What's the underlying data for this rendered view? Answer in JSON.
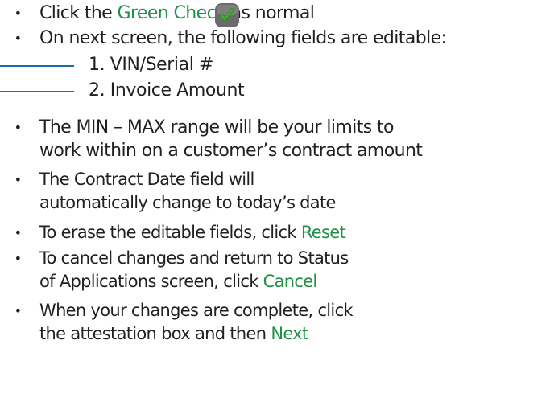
{
  "bullets": [
    {
      "lines": [
        {
          "pre": "Click the ",
          "accent": "Green Check",
          "post": " as normal"
        }
      ]
    },
    {
      "lines": [
        {
          "pre": "On next screen, the following fields are editable:",
          "accent": "",
          "post": ""
        }
      ]
    },
    {
      "lines": [
        {
          "pre": "The MIN – MAX range will be your limits to",
          "accent": "",
          "post": ""
        },
        {
          "pre": "work  within on a customer’s contract amount",
          "accent": "",
          "post": ""
        }
      ]
    },
    {
      "lines": [
        {
          "pre": "The Contract Date field will",
          "accent": "",
          "post": ""
        },
        {
          "pre": "automatically  change to today’s date",
          "accent": "",
          "post": ""
        }
      ]
    },
    {
      "lines": [
        {
          "pre": "To erase the editable fields, click ",
          "accent": "Reset",
          "post": ""
        }
      ]
    },
    {
      "lines": [
        {
          "pre": "To cancel changes and return to Status",
          "accent": "",
          "post": ""
        },
        {
          "pre": "of  Applications screen, click ",
          "accent": "Cancel",
          "post": ""
        }
      ]
    },
    {
      "lines": [
        {
          "pre": "When your changes are complete, click",
          "accent": "",
          "post": ""
        },
        {
          "pre": "the  attestation box and then ",
          "accent": "Next",
          "post": ""
        }
      ]
    }
  ],
  "bullet_char": "•",
  "editable_fields": [
    {
      "label": "1.  VIN/Serial #"
    },
    {
      "label": "2.  Invoice Amount"
    }
  ],
  "colors": {
    "text": "#231f20",
    "accent": "#1e9146",
    "rule": "#1d6ea6",
    "check_bg": "#6b6b6b",
    "check_mark": "#3cb32b"
  },
  "icons": {
    "green_check": "green-check-icon"
  }
}
